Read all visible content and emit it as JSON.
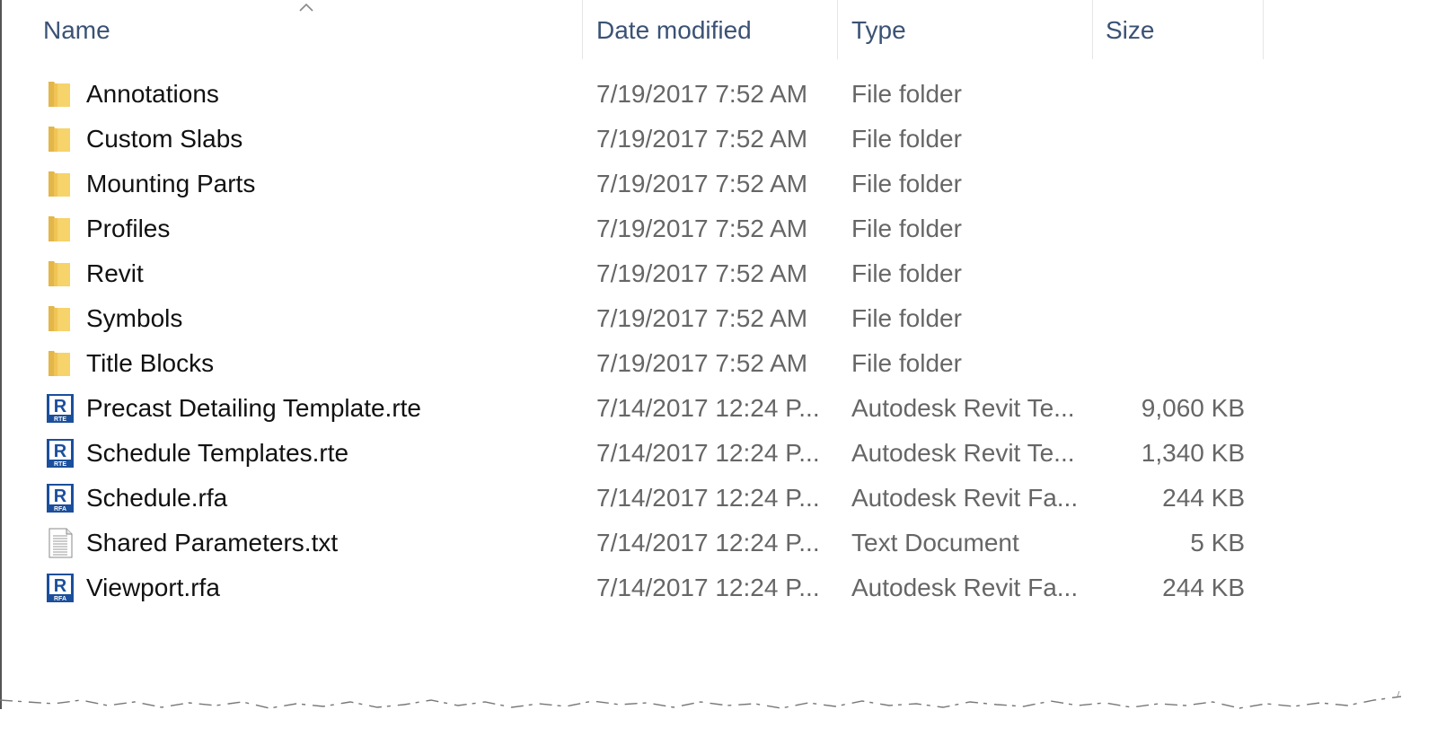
{
  "columns": {
    "name": "Name",
    "date": "Date modified",
    "type": "Type",
    "size": "Size"
  },
  "sort": {
    "column": "name",
    "direction": "ascending",
    "icon": "chevron-up-icon"
  },
  "rows": [
    {
      "name": "Annotations",
      "date": "7/19/2017 7:52 AM",
      "type": "File folder",
      "size": "",
      "icon": "folder-icon"
    },
    {
      "name": "Custom Slabs",
      "date": "7/19/2017 7:52 AM",
      "type": "File folder",
      "size": "",
      "icon": "folder-icon"
    },
    {
      "name": "Mounting Parts",
      "date": "7/19/2017 7:52 AM",
      "type": "File folder",
      "size": "",
      "icon": "folder-icon"
    },
    {
      "name": "Profiles",
      "date": "7/19/2017 7:52 AM",
      "type": "File folder",
      "size": "",
      "icon": "folder-icon"
    },
    {
      "name": "Revit",
      "date": "7/19/2017 7:52 AM",
      "type": "File folder",
      "size": "",
      "icon": "folder-icon"
    },
    {
      "name": "Symbols",
      "date": "7/19/2017 7:52 AM",
      "type": "File folder",
      "size": "",
      "icon": "folder-icon"
    },
    {
      "name": "Title Blocks",
      "date": "7/19/2017 7:52 AM",
      "type": "File folder",
      "size": "",
      "icon": "folder-icon"
    },
    {
      "name": "Precast Detailing Template.rte",
      "date": "7/14/2017 12:24 P...",
      "type": "Autodesk Revit Te...",
      "size": "9,060 KB",
      "icon": "revit-template-icon",
      "badge": "RTE"
    },
    {
      "name": "Schedule Templates.rte",
      "date": "7/14/2017 12:24 P...",
      "type": "Autodesk Revit Te...",
      "size": "1,340 KB",
      "icon": "revit-template-icon",
      "badge": "RTE"
    },
    {
      "name": "Schedule.rfa",
      "date": "7/14/2017 12:24 P...",
      "type": "Autodesk Revit Fa...",
      "size": "244 KB",
      "icon": "revit-family-icon",
      "badge": "RFA"
    },
    {
      "name": "Shared Parameters.txt",
      "date": "7/14/2017 12:24 P...",
      "type": "Text Document",
      "size": "5 KB",
      "icon": "text-document-icon"
    },
    {
      "name": "Viewport.rfa",
      "date": "7/14/2017 12:24 P...",
      "type": "Autodesk Revit Fa...",
      "size": "244 KB",
      "icon": "revit-family-icon",
      "badge": "RFA"
    }
  ],
  "colors": {
    "header_text": "#3b5275",
    "folder_yellow": "#f6d36b",
    "revit_blue": "#1b4f9c",
    "secondary_text": "#666666"
  }
}
